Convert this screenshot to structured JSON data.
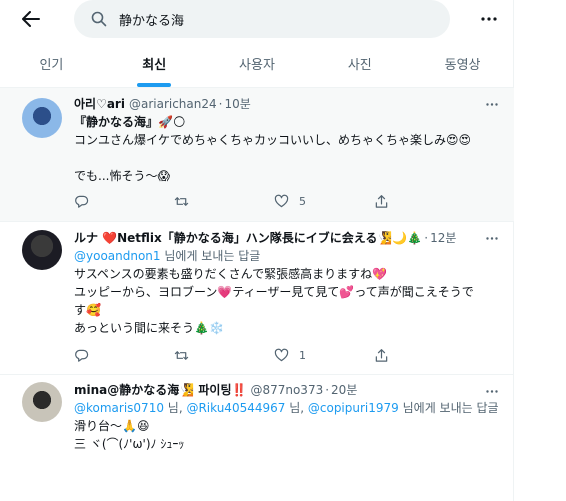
{
  "search": {
    "query": "静かなる海"
  },
  "tabs": [
    {
      "label": "인기"
    },
    {
      "label": "최신"
    },
    {
      "label": "사용자"
    },
    {
      "label": "사진"
    },
    {
      "label": "동영상"
    }
  ],
  "tweets": [
    {
      "name": "아리♡ari",
      "handle": "@ariarichan24",
      "time": "10분",
      "lines": [
        "『静かなる海』🚀🌕",
        "コンユさん爆イケでめちゃくちゃカッコいいし、めちゃくちゃ楽しみ😍😍",
        "",
        "でも...怖そう～😱"
      ],
      "reply_count": "",
      "retweet_count": "",
      "like_count": "5"
    },
    {
      "name": "ルナ ❤️Netflix「静かなる海」ハン隊長にイブに会える🧏🌙🎄",
      "handle": "",
      "time": "12분",
      "reply_mention": "@yooandnon1",
      "reply_suffix": " 님에게 보내는 답글",
      "lines": [
        "サスペンスの要素も盛りだくさんで緊張感高まりますね💖",
        "ユッピーから、ヨロブーン💗ティーザー見て見て💕って声が聞こえそうで",
        "す🥰",
        "あっという間に来そう🎄❄️"
      ],
      "reply_count": "",
      "retweet_count": "",
      "like_count": "1"
    },
    {
      "name": "mina@静かなる海🧏 파이팅‼️",
      "handle": "@877no373",
      "time": "20분",
      "reply_mentions": [
        "@komaris0710",
        "@Riku40544967",
        "@copipuri1979"
      ],
      "reply_sep_1": " 님, ",
      "reply_sep_2": " 님, ",
      "reply_suffix": " 님에게 보내는 답글",
      "lines": [
        "滑り台～🙏😆",
        "三 ヾ(⌒(ﾉ'ω')ﾉ ｼｭｰｯ"
      ]
    }
  ],
  "icons": {
    "back": "arrow-left-icon",
    "search": "search-icon",
    "more": "more-horizontal-icon",
    "reply": "reply-icon",
    "retweet": "retweet-icon",
    "like": "heart-icon",
    "share": "share-icon"
  },
  "colors": {
    "accent": "#1d9bf0",
    "muted": "#536471",
    "text": "#0f1419",
    "highlight_bg": "#f7f9f9"
  }
}
